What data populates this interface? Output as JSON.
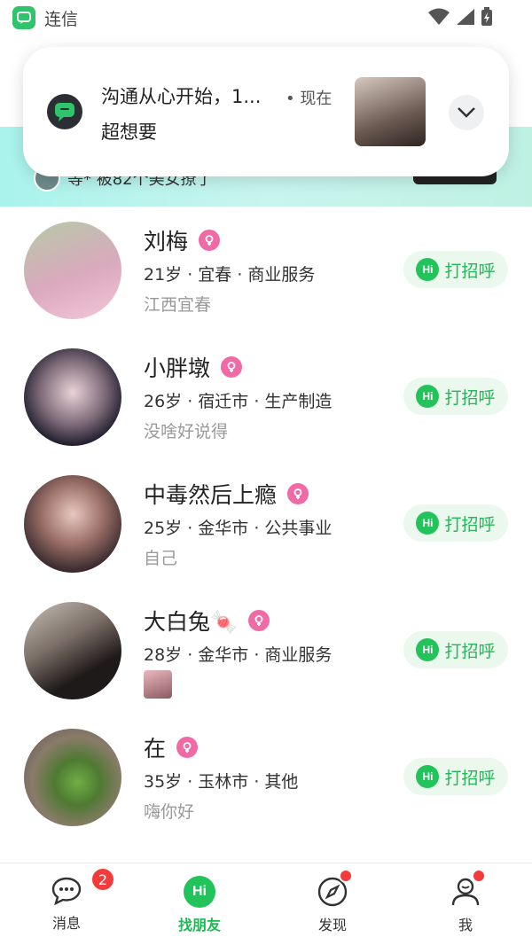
{
  "status_bar": {
    "app_name": "连信"
  },
  "banner": {
    "text": "等* 被82个美女撩了"
  },
  "notification": {
    "title": "沟通从心开始，1...",
    "time": "• 现在",
    "body": "超想要"
  },
  "users": [
    {
      "name": "刘梅",
      "info": "21岁 · 宜春 · 商业服务",
      "sign": "江西宜春",
      "greet": "打招呼"
    },
    {
      "name": "小胖墩",
      "info": "26岁 · 宿迁市 · 生产制造",
      "sign": "没啥好说得",
      "greet": "打招呼"
    },
    {
      "name": "中毒然后上瘾",
      "info": "25岁 · 金华市 · 公共事业",
      "sign": "自己",
      "greet": "打招呼"
    },
    {
      "name": "大白兔🍬",
      "info": "28岁 · 金华市 · 商业服务",
      "sign": "",
      "greet": "打招呼"
    },
    {
      "name": "在",
      "info": "35岁 · 玉林市 · 其他",
      "sign": "嗨你好",
      "greet": "打招呼"
    }
  ],
  "tabs": [
    {
      "label": "消息",
      "badge": "2"
    },
    {
      "label": "找朋友"
    },
    {
      "label": "发现"
    },
    {
      "label": "我"
    }
  ],
  "icons": {
    "hi": "Hi"
  }
}
